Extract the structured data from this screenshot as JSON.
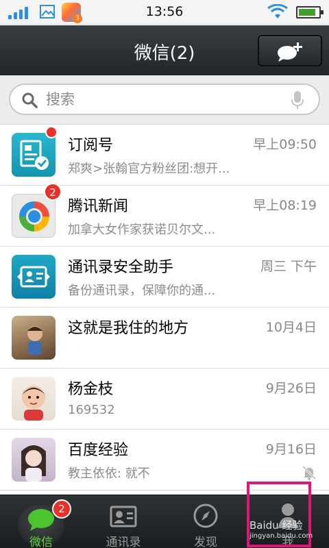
{
  "status_bar": {
    "time": "13:56",
    "app_badge_count": "3",
    "battery_level": 0.85
  },
  "header": {
    "title": "微信(2)",
    "compose_icon": "chat-bubble-plus-icon"
  },
  "search": {
    "placeholder": "搜索",
    "search_icon": "magnifier-icon",
    "voice_icon": "microphone-icon"
  },
  "chats": [
    {
      "name": "订阅号",
      "time": "早上09:50",
      "preview": "郑爽>张翰官方粉丝团:想开...",
      "badge": "",
      "has_dot": true,
      "avatar": "subscription-icon"
    },
    {
      "name": "腾讯新闻",
      "time": "早上08:19",
      "preview": "加拿大女作家获诺贝尔文...",
      "badge": "2",
      "has_dot": false,
      "avatar": "tencent-news-icon"
    },
    {
      "name": "通讯录安全助手",
      "time": "周三 下午",
      "preview": "备份通讯录，保障你的通...",
      "badge": "",
      "has_dot": false,
      "avatar": "contacts-backup-icon"
    },
    {
      "name": "这就是我住的地方",
      "time": "10月4日",
      "preview": "",
      "badge": "",
      "has_dot": false,
      "avatar": "child-photo"
    },
    {
      "name": "杨金枝",
      "time": "9月26日",
      "preview": "169532",
      "badge": "",
      "has_dot": false,
      "avatar": "baby-photo"
    },
    {
      "name": "百度经验",
      "time": "9月16日",
      "preview": "教主依依: 就不",
      "badge": "",
      "has_dot": false,
      "avatar": "girl-photo",
      "muted": true
    }
  ],
  "tabs": [
    {
      "label": "微信",
      "icon": "chat-bubble-icon",
      "badge": "2",
      "active": true
    },
    {
      "label": "通讯录",
      "icon": "contact-card-icon",
      "badge": "",
      "active": false
    },
    {
      "label": "发现",
      "icon": "compass-icon",
      "badge": "",
      "active": false
    },
    {
      "label": "我",
      "icon": "person-icon",
      "badge": "",
      "active": false
    }
  ],
  "watermark": {
    "line1": "Baidu 经验",
    "line2": "jingyan.baidu.com"
  },
  "colors": {
    "accent_green": "#5fd340",
    "badge_red": "#e8302a",
    "highlight": "#e0157a"
  }
}
